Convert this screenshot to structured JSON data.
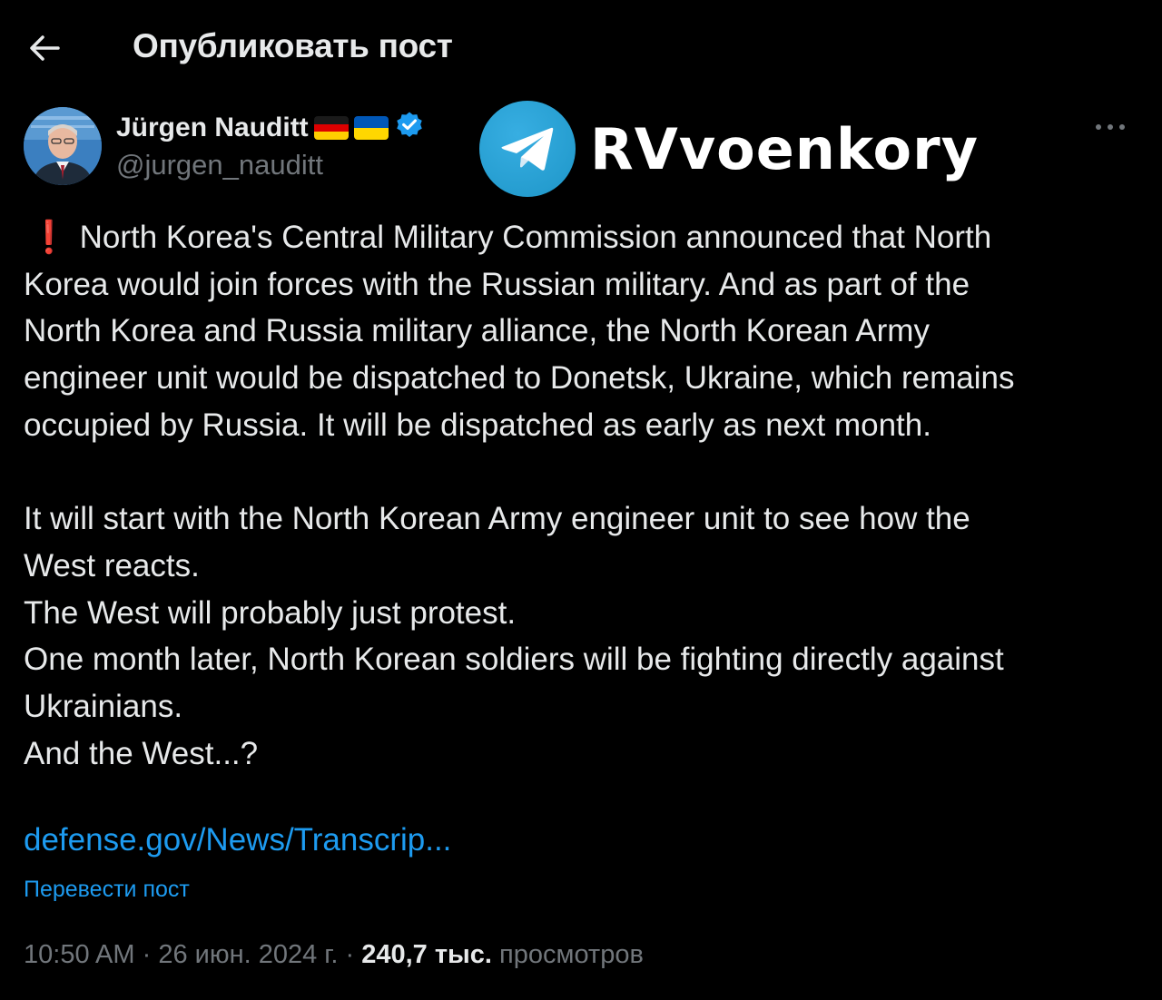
{
  "header": {
    "title": "Опубликовать пост"
  },
  "author": {
    "name": "Jürgen Nauditt",
    "handle": "@jurgen_nauditt"
  },
  "watermark": {
    "text": "RVvoenkory"
  },
  "post": {
    "excl_mark": "❗",
    "lines": [
      "North Korea's Central Military Commission announced that North",
      "Korea would join forces with the Russian military. And as part of the",
      "North Korea and Russia military alliance, the North Korean Army",
      "engineer unit would be dispatched to Donetsk, Ukraine, which remains",
      "occupied by Russia. It will be dispatched as early as next month.",
      "",
      "It will start with the North Korean Army engineer unit to see how the",
      "West reacts.",
      "The West will probably just protest.",
      "One month later, North Korean soldiers will be fighting directly against",
      "Ukrainians.",
      "And the West...?"
    ],
    "link": "defense.gov/News/Transcrip...",
    "translate_label": "Перевести пост"
  },
  "meta": {
    "time": "10:50 AM",
    "separator": "·",
    "date": "26 июн. 2024 г.",
    "views_count": "240,7 тыс.",
    "views_label": "просмотров"
  },
  "colors": {
    "background": "#000000",
    "text": "#e7e9ea",
    "secondary": "#71767b",
    "link": "#1d9bf0",
    "verified": "#1d9bf0",
    "telegram": "#2aa3dd"
  },
  "icons": {
    "back": "arrow-left-icon",
    "verified": "verified-badge-icon",
    "more": "more-dots-icon",
    "telegram": "telegram-logo-icon",
    "flag_de": "germany-flag-icon",
    "flag_ua": "ukraine-flag-icon"
  }
}
